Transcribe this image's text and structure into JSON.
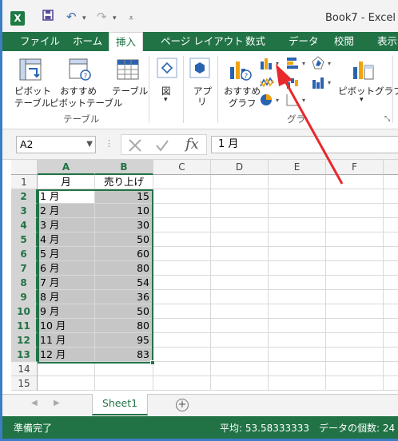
{
  "window": {
    "title": "Book7 - Excel",
    "app_icon": "X"
  },
  "tabs": [
    {
      "label": "ファイル"
    },
    {
      "label": "ホーム"
    },
    {
      "label": "挿入"
    },
    {
      "label": "ページ レイアウト"
    },
    {
      "label": "数式"
    },
    {
      "label": "データ"
    },
    {
      "label": "校閲"
    },
    {
      "label": "表示"
    }
  ],
  "ribbon": {
    "pivot_table_line1": "ピボット",
    "pivot_table_line2": "テーブル",
    "recommended_pivot_line1": "おすすめ",
    "recommended_pivot_line2": "ピボットテーブル",
    "table_label": "テーブル",
    "group_tables": "テーブル",
    "illustrations_label": "図",
    "apps_label": "アプ",
    "apps_label2": "リ",
    "recommended_charts_line1": "おすすめ",
    "recommended_charts_line2": "グラフ",
    "pivot_chart_label": "ピボットグラフ",
    "group_charts": "グラ"
  },
  "formula_bar": {
    "name_box": "A2",
    "formula": "1 月"
  },
  "columns": [
    "A",
    "B",
    "C",
    "D",
    "E",
    "F"
  ],
  "rows": [
    {
      "num": "1",
      "a": "月",
      "b": "売り上げ"
    },
    {
      "num": "2",
      "a": "1 月",
      "b": "15"
    },
    {
      "num": "3",
      "a": "2 月",
      "b": "10"
    },
    {
      "num": "4",
      "a": "3 月",
      "b": "30"
    },
    {
      "num": "5",
      "a": "4 月",
      "b": "50"
    },
    {
      "num": "6",
      "a": "5 月",
      "b": "60"
    },
    {
      "num": "7",
      "a": "6 月",
      "b": "80"
    },
    {
      "num": "8",
      "a": "7 月",
      "b": "54"
    },
    {
      "num": "9",
      "a": "8 月",
      "b": "36"
    },
    {
      "num": "10",
      "a": "9 月",
      "b": "50"
    },
    {
      "num": "11",
      "a": "10 月",
      "b": "80"
    },
    {
      "num": "12",
      "a": "11 月",
      "b": "95"
    },
    {
      "num": "13",
      "a": "12 月",
      "b": "83"
    },
    {
      "num": "14",
      "a": "",
      "b": ""
    },
    {
      "num": "15",
      "a": "",
      "b": ""
    }
  ],
  "sheets": {
    "active": "Sheet1",
    "add": "⊕"
  },
  "status": {
    "ready": "準備完了",
    "average": "平均: 53.58333333",
    "count": "データの個数: 24"
  },
  "colors": {
    "accent": "#217346",
    "selection": "#c6c6c6",
    "arrow": "#e8282b"
  }
}
